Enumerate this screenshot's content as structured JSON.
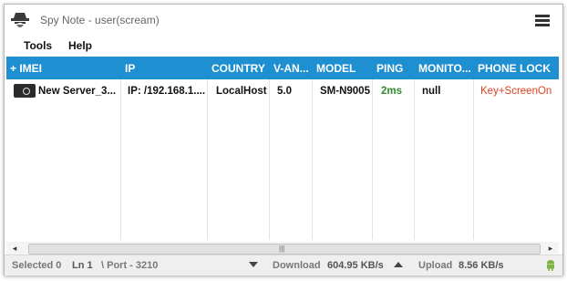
{
  "window": {
    "title": "Spy Note - user(scream)",
    "app_icon": "spy-hat-icon",
    "menu_icon": "hamburger-menu-icon"
  },
  "menu": {
    "tools": "Tools",
    "help": "Help"
  },
  "table": {
    "columns": [
      "+ IMEI",
      "IP",
      "COUNTRY",
      "V-AN...",
      "MODEL",
      "PING",
      "MONITO...",
      "PHONE LOCK"
    ],
    "rows": [
      {
        "imei": "New Server_3...",
        "ip": "IP: /192.168.1....",
        "country": "LocalHost",
        "version": "5.0",
        "model": "SM-N9005",
        "ping": "2ms",
        "monitor": "null",
        "phone_lock": "Key+ScreenOn"
      }
    ]
  },
  "scrollbar": {
    "left_arrow": "◂",
    "right_arrow": "▸",
    "grip": "|||"
  },
  "status": {
    "selected": "Selected 0",
    "line": "Ln 1",
    "port": "\\ Port - 3210",
    "download_label": "Download",
    "download_value": "604.95 KB/s",
    "upload_label": "Upload",
    "upload_value": "8.56 KB/s"
  },
  "colors": {
    "header_bg": "#1e8fd0",
    "ping_green": "#2e8b2e",
    "lock_red": "#e0401f",
    "android_green": "#7cb342"
  }
}
